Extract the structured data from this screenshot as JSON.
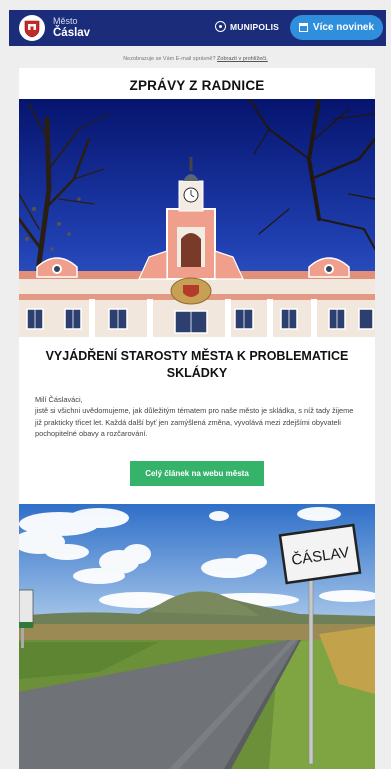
{
  "header": {
    "city_kind": "Město",
    "city_name": "Čáslav",
    "brand": "MUNIPOLIS",
    "more_news_label": "Více novinek"
  },
  "notice": {
    "text": "Nezobrazuje se Vám E-mail správně?",
    "link": "Zobrazit v prohlížeči."
  },
  "section": {
    "title": "ZPRÁVY Z RADNICE"
  },
  "article": {
    "title": "VYJÁDŘENÍ STAROSTY MĚSTA K PROBLEMATICE SKLÁDKY",
    "greeting": "Milí Čáslaváci,",
    "body": "jistě si všichni uvědomujeme, jak důležitým tématem pro naše město je skládka, s níž tady žijeme již prakticky třicet let. Každá další byť jen zamýšlená změna, vyvolává mezi zdejšími obyvateli pochopitelné obavy a rozčarování.",
    "cta_label": "Celý článek na webu města"
  },
  "photo2": {
    "sign_text": "ČÁSLAV"
  },
  "colors": {
    "header_bg": "#1b2d7a",
    "button_blue": "#2f8fdc",
    "button_green": "#36b36b"
  }
}
